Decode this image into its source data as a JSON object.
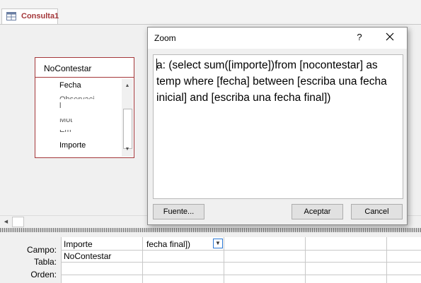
{
  "document_tab": {
    "label": "Consulta1",
    "icon": "query-icon"
  },
  "table_box": {
    "title": "NoContestar",
    "fields": [
      {
        "label": "Fecha",
        "partial": false
      },
      {
        "label": "Observaci",
        "partial": true
      },
      {
        "label": "l",
        "partial": true
      },
      {
        "label": "Mot",
        "partial": true
      },
      {
        "label": "Em",
        "partial": true
      },
      {
        "label": "Importe",
        "partial": false
      }
    ]
  },
  "zoom_dialog": {
    "title": "Zoom",
    "help_label": "?",
    "close_icon": "close-icon",
    "expression": "a: (select sum([importe])from [nocontestar] as temp where [fecha] between [escriba una fecha inicial] and [escriba una fecha final])",
    "font_button": "Fuente...",
    "ok_button": "Aceptar",
    "cancel_button": "Cancel"
  },
  "design_grid": {
    "row_labels": {
      "campo": "Campo:",
      "tabla": "Tabla:",
      "orden": "Orden:"
    },
    "columns": [
      {
        "campo": "Importe",
        "tabla": "NoContestar"
      },
      {
        "campo": "fecha final])",
        "tabla": ""
      }
    ]
  },
  "colors": {
    "accent": "#a4373a",
    "focus_border": "#2b78d5"
  }
}
